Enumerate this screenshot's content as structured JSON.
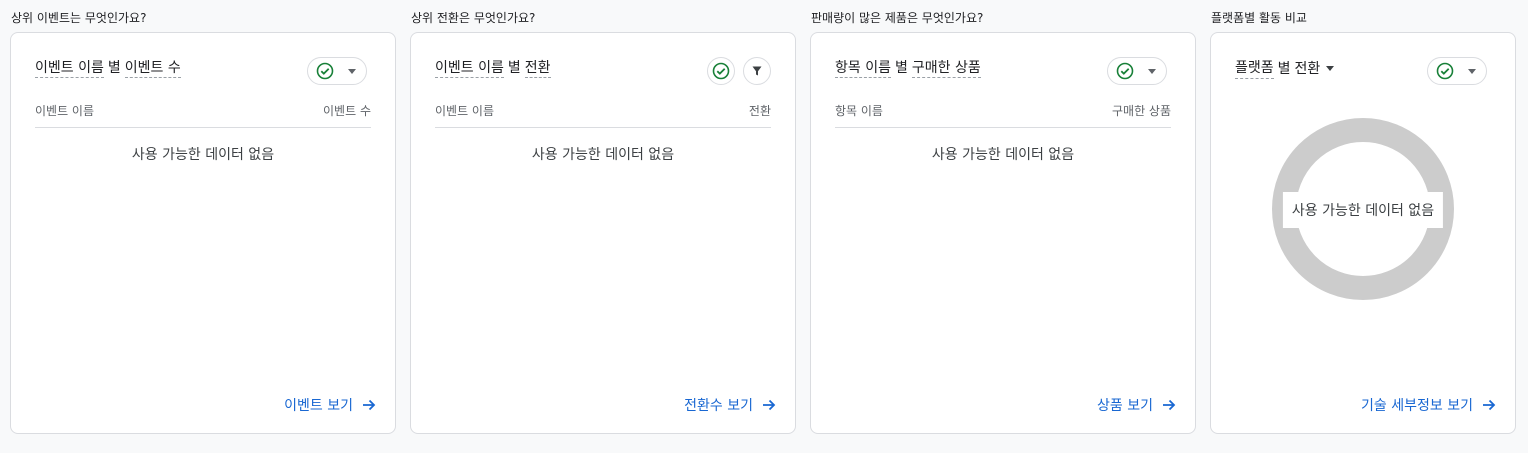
{
  "colors": {
    "check": "#188038",
    "link": "#1967d2",
    "donut": "#cccccc"
  },
  "cards": [
    {
      "section_title": "상위 이벤트는 무엇인가요?",
      "title_dim1": "이벤트 이름",
      "title_sep": "별",
      "title_dim2": "이벤트 수",
      "col_left": "이벤트 이름",
      "col_right": "이벤트 수",
      "no_data": "사용 가능한 데이터 없음",
      "link": "이벤트 보기",
      "icons": [
        "check-circle-icon",
        "chevron-down-icon",
        "arrow-right-icon"
      ]
    },
    {
      "section_title": "상위 전환은 무엇인가요?",
      "title_dim1": "이벤트 이름",
      "title_sep": "별",
      "title_dim2": "전환",
      "col_left": "이벤트 이름",
      "col_right": "전환",
      "no_data": "사용 가능한 데이터 없음",
      "link": "전환수 보기",
      "icons": [
        "check-circle-icon",
        "filter-icon",
        "arrow-right-icon"
      ]
    },
    {
      "section_title": "판매량이 많은 제품은 무엇인가요?",
      "title_dim1": "항목 이름",
      "title_sep": "별",
      "title_dim2": "구매한 상품",
      "col_left": "항목 이름",
      "col_right": "구매한 상품",
      "no_data": "사용 가능한 데이터 없음",
      "link": "상품 보기",
      "icons": [
        "check-circle-icon",
        "chevron-down-icon",
        "arrow-right-icon"
      ]
    },
    {
      "section_title": "플랫폼별 활동 비교",
      "title_dim1": "플랫폼",
      "title_sep": "별",
      "title_dim2": "전환",
      "no_data": "사용 가능한 데이터 없음",
      "link": "기술 세부정보 보기",
      "icons": [
        "check-circle-icon",
        "chevron-down-icon",
        "caret-down-icon",
        "arrow-right-icon"
      ]
    }
  ]
}
